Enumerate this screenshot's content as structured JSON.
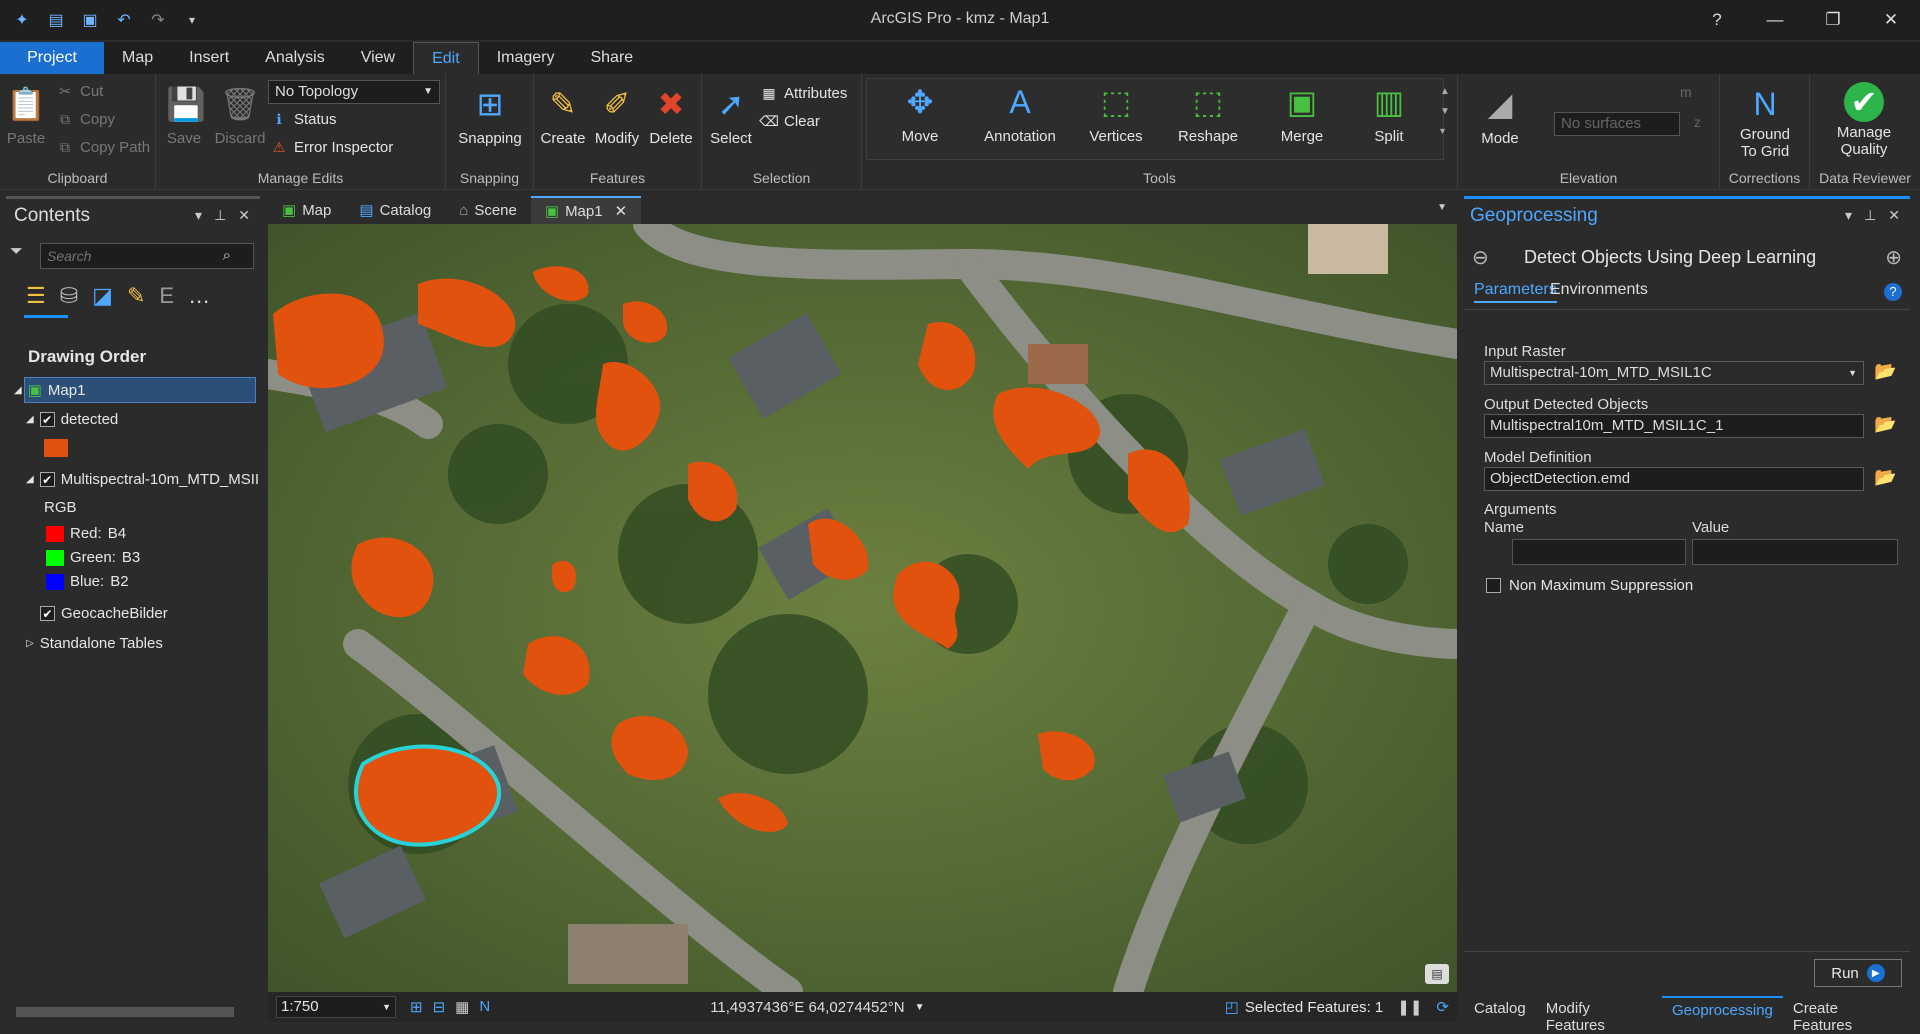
{
  "app": {
    "title": "ArcGIS Pro - kmz - Map1"
  },
  "window": {
    "help": "?",
    "minimize": "—",
    "restore": "❐",
    "close": "✕"
  },
  "tabs": [
    {
      "label": "Project"
    },
    {
      "label": "Map"
    },
    {
      "label": "Insert"
    },
    {
      "label": "Analysis"
    },
    {
      "label": "View"
    },
    {
      "label": "Edit"
    },
    {
      "label": "Imagery"
    },
    {
      "label": "Share"
    }
  ],
  "ribbon": {
    "clipboard": {
      "label": "Clipboard",
      "paste": "Paste",
      "cut": "Cut",
      "copy": "Copy",
      "copy_path": "Copy Path"
    },
    "manage_edits": {
      "label": "Manage Edits",
      "save": "Save",
      "discard": "Discard",
      "topology": "No Topology",
      "status": "Status",
      "error_inspector": "Error Inspector"
    },
    "snapping": {
      "label": "Snapping",
      "snapping": "Snapping"
    },
    "features": {
      "label": "Features",
      "create": "Create",
      "modify": "Modify",
      "delete": "Delete"
    },
    "selection": {
      "label": "Selection",
      "select": "Select",
      "attributes": "Attributes",
      "clear": "Clear"
    },
    "tools": {
      "label": "Tools",
      "move": "Move",
      "annotation": "Annotation",
      "vertices": "Vertices",
      "reshape": "Reshape",
      "merge": "Merge",
      "split": "Split"
    },
    "elevation": {
      "label": "Elevation",
      "mode": "Mode",
      "surfaces_placeholder": "No surfaces",
      "m": "m",
      "z": "z"
    },
    "corrections": {
      "label": "Corrections",
      "ground": "Ground",
      "to_grid": "To Grid"
    },
    "data_reviewer": {
      "label": "Data Reviewer",
      "manage": "Manage",
      "quality": "Quality"
    }
  },
  "contents": {
    "title": "Contents",
    "search_placeholder": "Search",
    "drawing_order": "Drawing Order",
    "map": "Map1",
    "layer_detected": "detected",
    "layer_raster": "Multispectral-10m_MTD_MSII",
    "rgb": "RGB",
    "bands": [
      {
        "label": "Red:",
        "band": "B4",
        "color": "#ff0000"
      },
      {
        "label": "Green:",
        "band": "B3",
        "color": "#00ff00"
      },
      {
        "label": "Blue:",
        "band": "B2",
        "color": "#0000ff"
      }
    ],
    "layer_geocache": "GeocacheBilder",
    "standalone": "Standalone Tables",
    "detected_color": "#e0520e"
  },
  "view_tabs": [
    {
      "label": "Map"
    },
    {
      "label": "Catalog"
    },
    {
      "label": "Scene"
    },
    {
      "label": "Map1"
    }
  ],
  "status": {
    "scale": "1:750",
    "coords": "11,4937436°E 64,0274452°N",
    "selected": "Selected Features: 1"
  },
  "geoprocessing": {
    "title": "Geoprocessing",
    "tool": "Detect Objects Using Deep Learning",
    "tab_parameters": "Parameters",
    "tab_environments": "Environments",
    "input_raster_label": "Input Raster",
    "input_raster": "Multispectral-10m_MTD_MSIL1C",
    "output_label": "Output Detected Objects",
    "output": "Multispectral10m_MTD_MSIL1C_1",
    "model_label": "Model Definition",
    "model": "ObjectDetection.emd",
    "arguments": "Arguments",
    "name_col": "Name",
    "value_col": "Value",
    "nms": "Non Maximum Suppression",
    "run": "Run"
  },
  "bottom_tabs": [
    {
      "label": "Catalog"
    },
    {
      "label": "Modify Features"
    },
    {
      "label": "Geoprocessing"
    },
    {
      "label": "Create Features"
    }
  ]
}
